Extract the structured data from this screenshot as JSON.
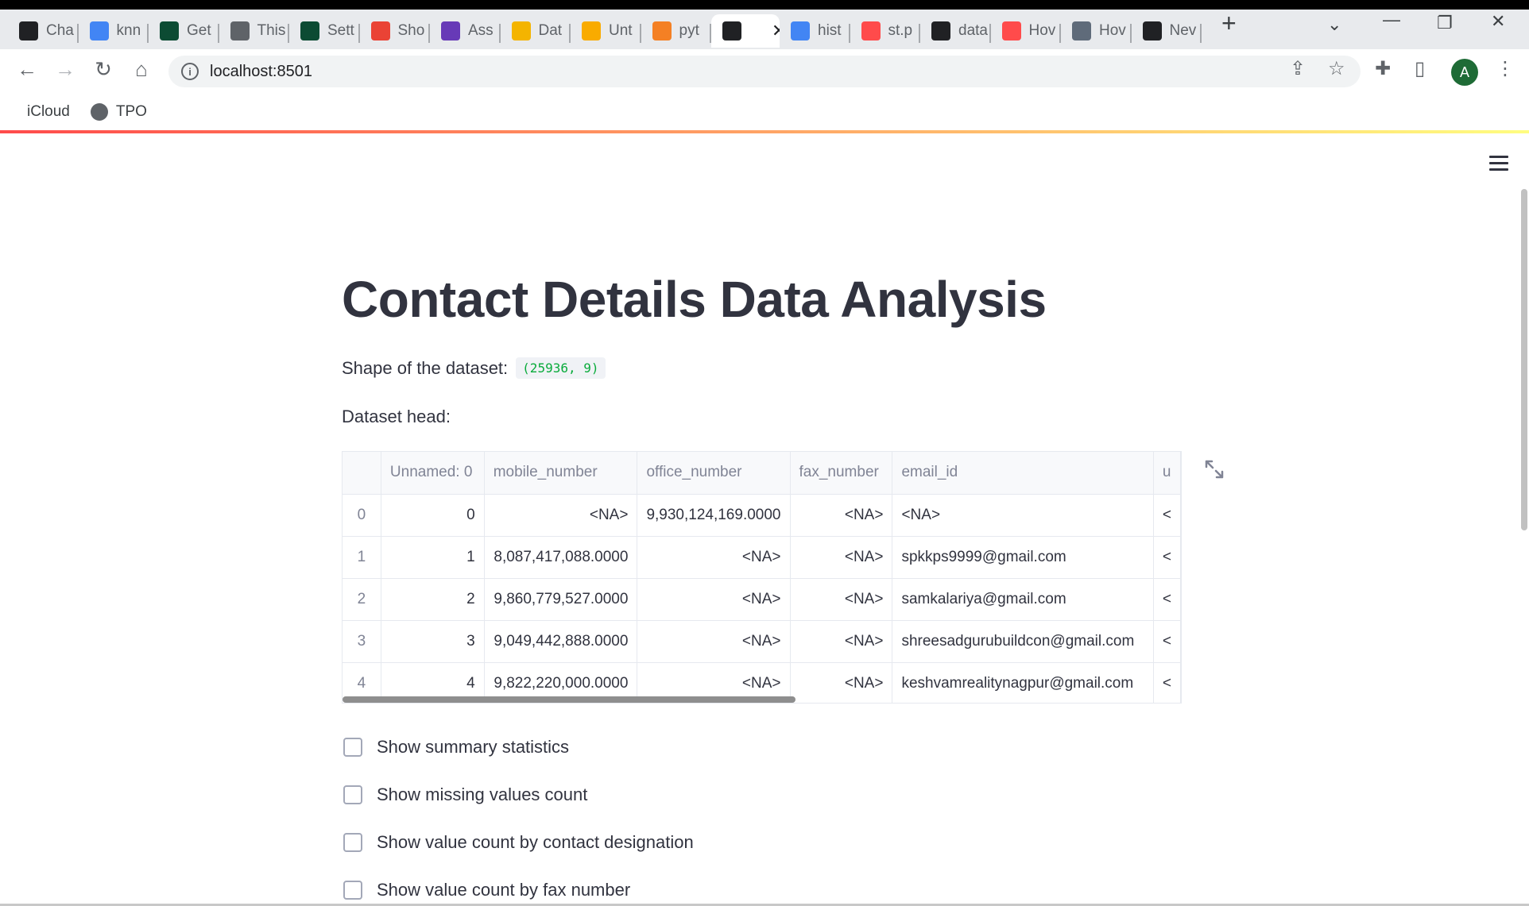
{
  "browser": {
    "tabs": [
      {
        "label": "Cha",
        "icon": "openai-icon",
        "color": "#202124"
      },
      {
        "label": "knn",
        "icon": "google-icon",
        "color": "#4285f4"
      },
      {
        "label": "Get",
        "icon": "django-icon",
        "color": "#0c4b33"
      },
      {
        "label": "This",
        "icon": "globe-icon",
        "color": "#5f6368"
      },
      {
        "label": "Sett",
        "icon": "django-icon",
        "color": "#0c4b33"
      },
      {
        "label": "Sho",
        "icon": "gmail-icon",
        "color": "#ea4335"
      },
      {
        "label": "Ass",
        "icon": "forms-icon",
        "color": "#673ab7"
      },
      {
        "label": "Dat",
        "icon": "data-icon",
        "color": "#f4b400"
      },
      {
        "label": "Unt",
        "icon": "colab-icon",
        "color": "#f9ab00"
      },
      {
        "label": "pyt",
        "icon": "stackoverflow-icon",
        "color": "#f48024"
      },
      {
        "label": "",
        "icon": "streamlit-icon",
        "color": "#202124"
      },
      {
        "label": "hist",
        "icon": "google-icon",
        "color": "#4285f4"
      },
      {
        "label": "st.p",
        "icon": "streamlit-crown-icon",
        "color": "#ff4b4b"
      },
      {
        "label": "data",
        "icon": "streamlit-icon",
        "color": "#202124"
      },
      {
        "label": "Hov",
        "icon": "streamlit-crown-icon",
        "color": "#ff4b4b"
      },
      {
        "label": "Hov",
        "icon": "user-photo-icon",
        "color": "#5f6b7a"
      },
      {
        "label": "Nev",
        "icon": "github-icon",
        "color": "#202124"
      }
    ],
    "address": "localhost:8501",
    "bookmarks": [
      {
        "label": "iCloud",
        "icon": "apple-icon"
      },
      {
        "label": "TPO",
        "icon": "globe-icon"
      }
    ],
    "profile_initial": "A"
  },
  "page": {
    "title": "Contact Details Data Analysis",
    "shape_label": "Shape of the dataset:",
    "shape_value": "(25936, 9)",
    "head_label": "Dataset head:"
  },
  "dataframe": {
    "columns": [
      "",
      "Unnamed: 0",
      "mobile_number",
      "office_number",
      "fax_number",
      "email_id",
      "u"
    ],
    "rows": [
      [
        "0",
        "0",
        "<NA>",
        "9,930,124,169.0000",
        "<NA>",
        "<NA>",
        "<"
      ],
      [
        "1",
        "1",
        "8,087,417,088.0000",
        "<NA>",
        "<NA>",
        "spkkps9999@gmail.com",
        "<"
      ],
      [
        "2",
        "2",
        "9,860,779,527.0000",
        "<NA>",
        "<NA>",
        "samkalariya@gmail.com",
        "<"
      ],
      [
        "3",
        "3",
        "9,049,442,888.0000",
        "<NA>",
        "<NA>",
        "shreesadgurubuildcon@gmail.com",
        "<"
      ],
      [
        "4",
        "4",
        "9,822,220,000.0000",
        "<NA>",
        "<NA>",
        "keshvamrealitynagpur@gmail.com",
        "<"
      ]
    ]
  },
  "checkboxes": [
    {
      "label": "Show summary statistics",
      "checked": false
    },
    {
      "label": "Show missing values count",
      "checked": false
    },
    {
      "label": "Show value count by contact designation",
      "checked": false
    },
    {
      "label": "Show value count by fax number",
      "checked": false
    }
  ]
}
